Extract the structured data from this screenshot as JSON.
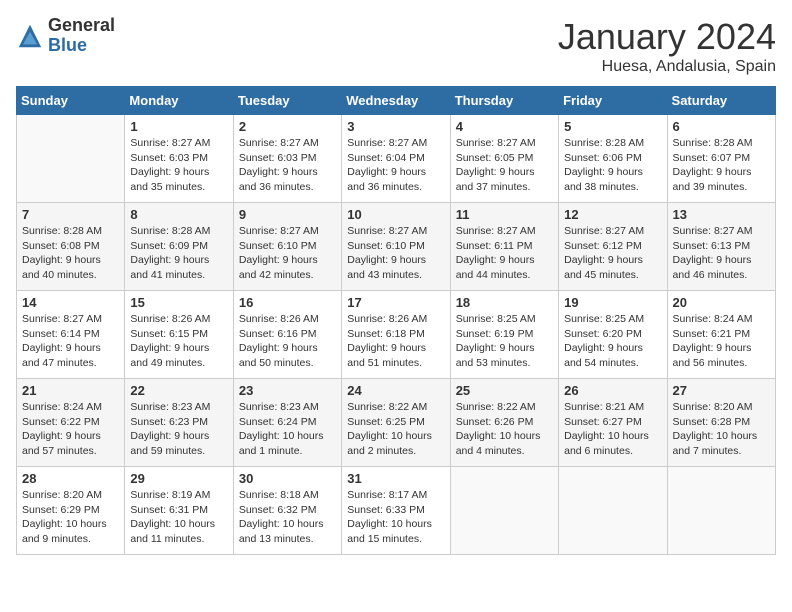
{
  "logo": {
    "general": "General",
    "blue": "Blue"
  },
  "title": "January 2024",
  "subtitle": "Huesa, Andalusia, Spain",
  "headers": [
    "Sunday",
    "Monday",
    "Tuesday",
    "Wednesday",
    "Thursday",
    "Friday",
    "Saturday"
  ],
  "weeks": [
    [
      {
        "day": "",
        "info": ""
      },
      {
        "day": "1",
        "info": "Sunrise: 8:27 AM\nSunset: 6:03 PM\nDaylight: 9 hours\nand 35 minutes."
      },
      {
        "day": "2",
        "info": "Sunrise: 8:27 AM\nSunset: 6:03 PM\nDaylight: 9 hours\nand 36 minutes."
      },
      {
        "day": "3",
        "info": "Sunrise: 8:27 AM\nSunset: 6:04 PM\nDaylight: 9 hours\nand 36 minutes."
      },
      {
        "day": "4",
        "info": "Sunrise: 8:27 AM\nSunset: 6:05 PM\nDaylight: 9 hours\nand 37 minutes."
      },
      {
        "day": "5",
        "info": "Sunrise: 8:28 AM\nSunset: 6:06 PM\nDaylight: 9 hours\nand 38 minutes."
      },
      {
        "day": "6",
        "info": "Sunrise: 8:28 AM\nSunset: 6:07 PM\nDaylight: 9 hours\nand 39 minutes."
      }
    ],
    [
      {
        "day": "7",
        "info": "Sunrise: 8:28 AM\nSunset: 6:08 PM\nDaylight: 9 hours\nand 40 minutes."
      },
      {
        "day": "8",
        "info": "Sunrise: 8:28 AM\nSunset: 6:09 PM\nDaylight: 9 hours\nand 41 minutes."
      },
      {
        "day": "9",
        "info": "Sunrise: 8:27 AM\nSunset: 6:10 PM\nDaylight: 9 hours\nand 42 minutes."
      },
      {
        "day": "10",
        "info": "Sunrise: 8:27 AM\nSunset: 6:10 PM\nDaylight: 9 hours\nand 43 minutes."
      },
      {
        "day": "11",
        "info": "Sunrise: 8:27 AM\nSunset: 6:11 PM\nDaylight: 9 hours\nand 44 minutes."
      },
      {
        "day": "12",
        "info": "Sunrise: 8:27 AM\nSunset: 6:12 PM\nDaylight: 9 hours\nand 45 minutes."
      },
      {
        "day": "13",
        "info": "Sunrise: 8:27 AM\nSunset: 6:13 PM\nDaylight: 9 hours\nand 46 minutes."
      }
    ],
    [
      {
        "day": "14",
        "info": "Sunrise: 8:27 AM\nSunset: 6:14 PM\nDaylight: 9 hours\nand 47 minutes."
      },
      {
        "day": "15",
        "info": "Sunrise: 8:26 AM\nSunset: 6:15 PM\nDaylight: 9 hours\nand 49 minutes."
      },
      {
        "day": "16",
        "info": "Sunrise: 8:26 AM\nSunset: 6:16 PM\nDaylight: 9 hours\nand 50 minutes."
      },
      {
        "day": "17",
        "info": "Sunrise: 8:26 AM\nSunset: 6:18 PM\nDaylight: 9 hours\nand 51 minutes."
      },
      {
        "day": "18",
        "info": "Sunrise: 8:25 AM\nSunset: 6:19 PM\nDaylight: 9 hours\nand 53 minutes."
      },
      {
        "day": "19",
        "info": "Sunrise: 8:25 AM\nSunset: 6:20 PM\nDaylight: 9 hours\nand 54 minutes."
      },
      {
        "day": "20",
        "info": "Sunrise: 8:24 AM\nSunset: 6:21 PM\nDaylight: 9 hours\nand 56 minutes."
      }
    ],
    [
      {
        "day": "21",
        "info": "Sunrise: 8:24 AM\nSunset: 6:22 PM\nDaylight: 9 hours\nand 57 minutes."
      },
      {
        "day": "22",
        "info": "Sunrise: 8:23 AM\nSunset: 6:23 PM\nDaylight: 9 hours\nand 59 minutes."
      },
      {
        "day": "23",
        "info": "Sunrise: 8:23 AM\nSunset: 6:24 PM\nDaylight: 10 hours\nand 1 minute."
      },
      {
        "day": "24",
        "info": "Sunrise: 8:22 AM\nSunset: 6:25 PM\nDaylight: 10 hours\nand 2 minutes."
      },
      {
        "day": "25",
        "info": "Sunrise: 8:22 AM\nSunset: 6:26 PM\nDaylight: 10 hours\nand 4 minutes."
      },
      {
        "day": "26",
        "info": "Sunrise: 8:21 AM\nSunset: 6:27 PM\nDaylight: 10 hours\nand 6 minutes."
      },
      {
        "day": "27",
        "info": "Sunrise: 8:20 AM\nSunset: 6:28 PM\nDaylight: 10 hours\nand 7 minutes."
      }
    ],
    [
      {
        "day": "28",
        "info": "Sunrise: 8:20 AM\nSunset: 6:29 PM\nDaylight: 10 hours\nand 9 minutes."
      },
      {
        "day": "29",
        "info": "Sunrise: 8:19 AM\nSunset: 6:31 PM\nDaylight: 10 hours\nand 11 minutes."
      },
      {
        "day": "30",
        "info": "Sunrise: 8:18 AM\nSunset: 6:32 PM\nDaylight: 10 hours\nand 13 minutes."
      },
      {
        "day": "31",
        "info": "Sunrise: 8:17 AM\nSunset: 6:33 PM\nDaylight: 10 hours\nand 15 minutes."
      },
      {
        "day": "",
        "info": ""
      },
      {
        "day": "",
        "info": ""
      },
      {
        "day": "",
        "info": ""
      }
    ]
  ]
}
